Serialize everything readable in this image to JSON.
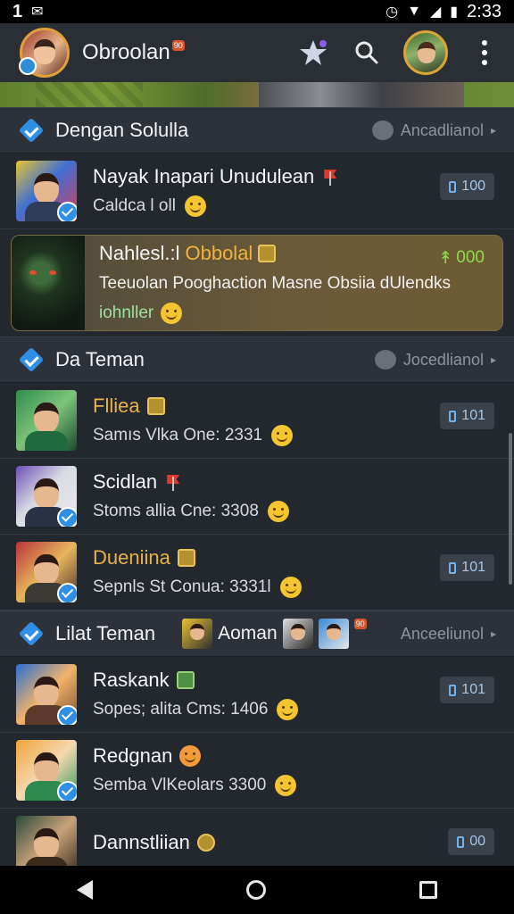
{
  "status_bar": {
    "left_text": "1",
    "time": "2:33"
  },
  "app": {
    "title": "Obroolan",
    "title_badge": "90"
  },
  "sections": [
    {
      "title": "Dengan Solulla",
      "action_label": "Ancadlianol",
      "rows": [
        {
          "name": "Nayak Inapari Unudulean",
          "subtitle": "Caldca l oll",
          "badge": "100"
        }
      ]
    },
    {
      "title": "Da Teman",
      "action_label": "Jocedlianol",
      "rows": [
        {
          "name": "Flliea",
          "subtitle": "Samıs Vlka One: 2331",
          "badge": "101"
        },
        {
          "name": "Scidlan",
          "subtitle": "Stoms allia Cne: 3308",
          "badge": ""
        },
        {
          "name": "Dueniina",
          "subtitle": "Sepnls St Conua: 3331l",
          "badge": "101"
        }
      ]
    },
    {
      "title": "Lilat Teman",
      "action_label": "Anceeliunol",
      "middle_label": "Aoman",
      "middle_badge": "90",
      "rows": [
        {
          "name": "Raskank",
          "subtitle": "Sopes; alita Cms: 1406",
          "badge": "101"
        },
        {
          "name": "Redgnan",
          "subtitle": "Semba VlKeolars 3300",
          "badge": ""
        },
        {
          "name": "Dannstliian",
          "subtitle": "",
          "badge": "00"
        }
      ]
    }
  ],
  "featured": {
    "title_prefix": "Nahlesl.:l",
    "title_highlight": "Obbolal",
    "line1": "Teeuolan Pooghaction Masne Obsiia dUlendks",
    "line2": "iohnller",
    "count": "000"
  },
  "colors": {
    "accent_blue": "#2f8fe6",
    "gold": "#e8b24a",
    "featured_bg": "#6b5b38",
    "green_count": "#8bdc4e"
  }
}
